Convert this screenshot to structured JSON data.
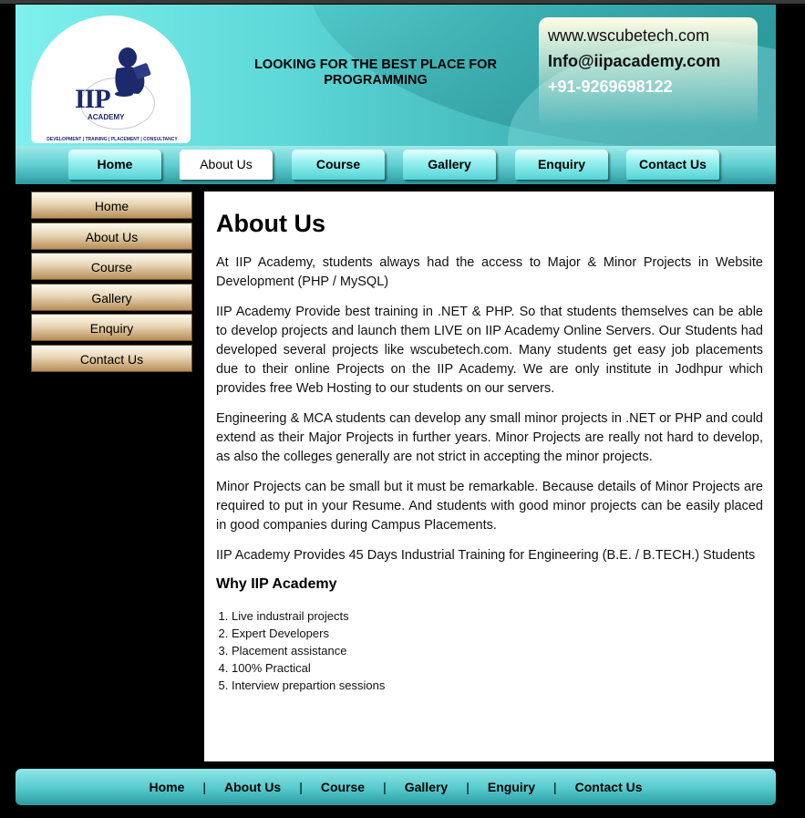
{
  "header": {
    "logo_name": "IIP",
    "logo_sub": "ACADEMY",
    "logo_tagline": "DEVELOPMENT | TRAINING | PLACEMENT | CONSULTANCY",
    "tagline": "LOOKING FOR THE BEST PLACE FOR PROGRAMMING",
    "website": "www.wscubetech.com",
    "email": "Info@iipacademy.com",
    "phone": "+91-9269698122"
  },
  "topnav": {
    "items": [
      {
        "label": "Home"
      },
      {
        "label": "About Us"
      },
      {
        "label": "Course"
      },
      {
        "label": "Gallery"
      },
      {
        "label": "Enquiry"
      },
      {
        "label": "Contact Us"
      }
    ]
  },
  "sidebar": {
    "items": [
      {
        "label": "Home"
      },
      {
        "label": "About Us"
      },
      {
        "label": "Course"
      },
      {
        "label": "Gallery"
      },
      {
        "label": "Enquiry"
      },
      {
        "label": "Contact Us"
      }
    ]
  },
  "content": {
    "title": "About Us",
    "paragraphs": [
      "At IIP Academy, students always had the access to Major & Minor Projects in Website Development (PHP / MySQL)",
      "IIP Academy Provide best training in .NET & PHP. So that students themselves can be able to develop projects and launch them LIVE on IIP Academy Online Servers. Our Students had developed several projects like wscubetech.com. Many students get easy job placements due to their online Projects on the IIP Academy. We are only institute in Jodhpur which provides free Web Hosting to our students on our servers.",
      "Engineering & MCA students can develop any small minor projects in .NET or PHP and could extend as their Major Projects in further years. Minor Projects are really not hard to develop, as also the colleges generally are not strict in accepting the minor projects.",
      "Minor Projects can be small but it must be remarkable. Because details of Minor Projects are required to put in your Resume. And students with good minor projects can be easily placed in good companies during Campus Placements.",
      "IIP Academy Provides 45 Days Industrial Training for Engineering (B.E. / B.TECH.) Students"
    ],
    "why_title": "Why IIP Academy",
    "why_list": [
      "Live industrail projects",
      "Expert Developers",
      "Placement assistance",
      "100% Practical",
      "Interview prepartion sessions"
    ]
  },
  "footer": {
    "links": [
      "Home",
      "About Us",
      "Course",
      "Gallery",
      "Enguiry",
      "Contact Us"
    ],
    "separator": "|"
  },
  "colors": {
    "header_cyan": "#5ed8d8",
    "sidebar_tan": "#e8d6b6",
    "background": "#000000"
  },
  "icons": {
    "logo": "reading-child-icon"
  }
}
